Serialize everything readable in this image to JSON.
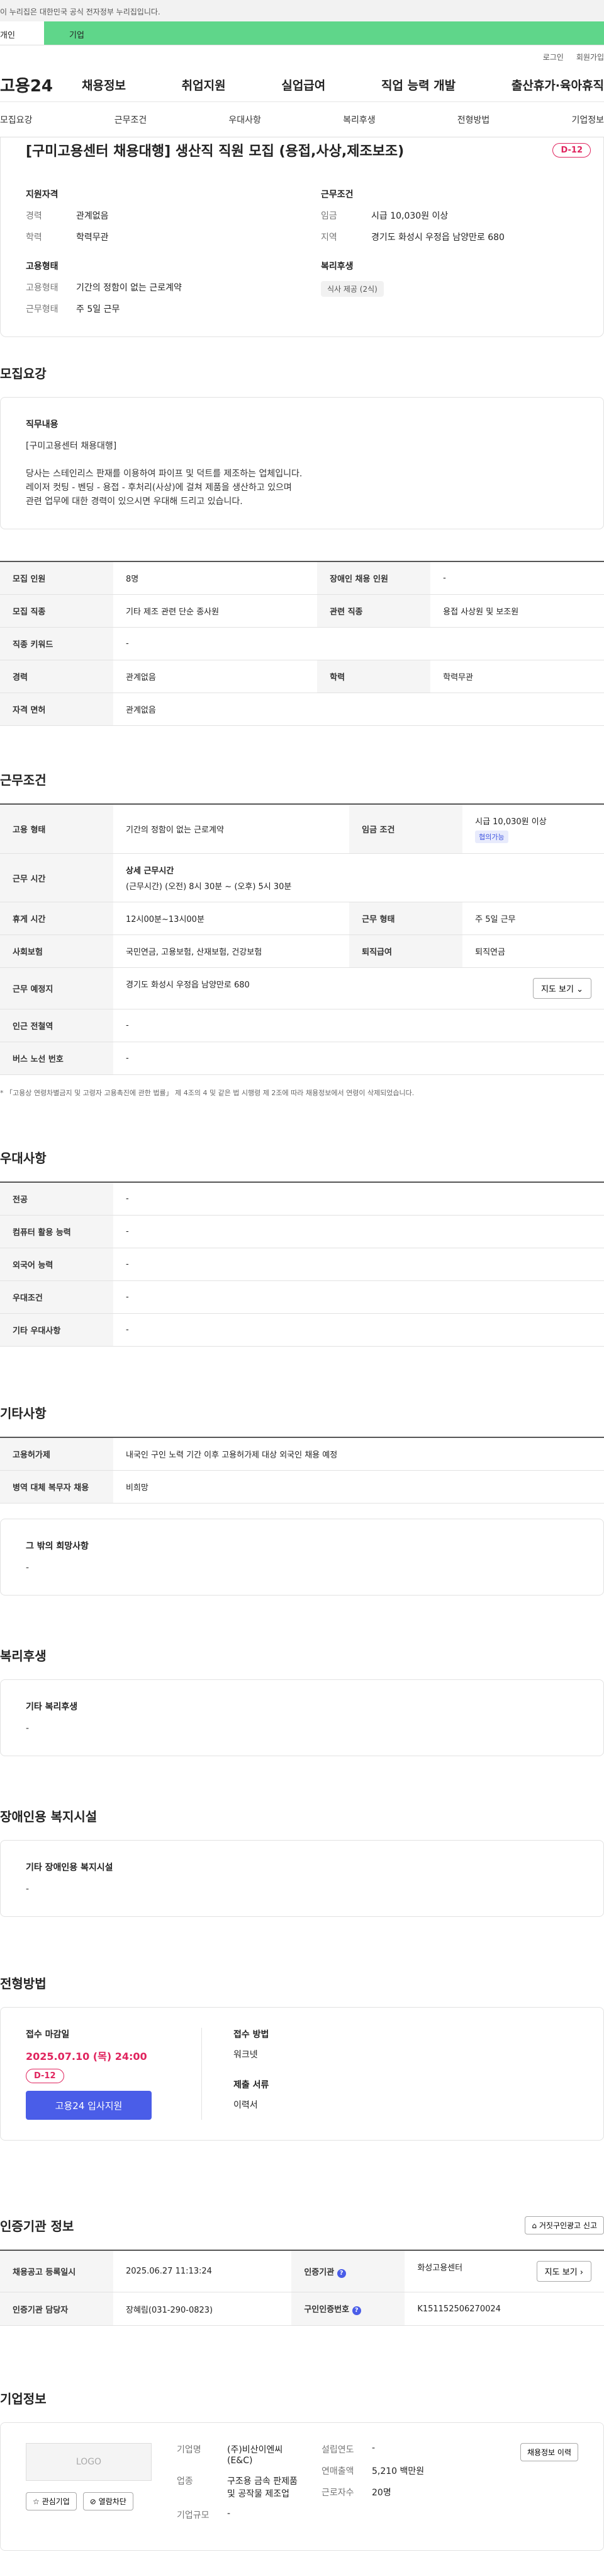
{
  "gov_banner": "이 누리집은 대한민국 공식 전자정부 누리집입니다.",
  "tabs": {
    "personal": "개인",
    "company": "기업"
  },
  "util": {
    "login": "로그인",
    "signup": "회원가입"
  },
  "site_logo": "고용24",
  "gnb": [
    "채용정보",
    "취업지원",
    "실업급여",
    "직업 능력 개발",
    "출산휴가·육아휴직"
  ],
  "anchors": [
    "모집요강",
    "근무조건",
    "우대사항",
    "복리후생",
    "전형방법",
    "기업정보"
  ],
  "header": {
    "title": "[구미고용센터 채용대행] 생산직 직원 모집 (용접,사상,제조보조)",
    "dday": "D-12",
    "qualification_title": "지원자격",
    "career_label": "경력",
    "career": "관계없음",
    "edu_label": "학력",
    "edu": "학력무관",
    "conditions_title": "근무조건",
    "wage_label": "임금",
    "wage": "시급 10,030원 이상",
    "region_label": "지역",
    "region": "경기도 화성시 우정읍 남양만로 680",
    "type_title": "고용형태",
    "emp_label": "고용형태",
    "emp": "기간의 정함이 없는 근로계약",
    "worktype_label": "근무형태",
    "worktype": "주 5일 근무",
    "welfare_title": "복리후생",
    "welfare_chip": "식사 제공 (2식)"
  },
  "recruit": {
    "section_title": "모집요강",
    "duty_title": "직무내용",
    "duty_tag": "[구미고용센터 채용대행]",
    "duty_desc1": "당사는 스테인리스 판재를 이용하여 파이프 및 덕트를 제조하는 업체입니다.",
    "duty_desc2": "레이저 컷팅 - 벤딩 - 용접 - 후처리(사상)에 걸쳐 제품을 생산하고 있으며",
    "duty_desc3": "관련 업무에 대한 경력이 있으시면 우대해 드리고 있습니다.",
    "rows": [
      [
        "모집 인원",
        "8명",
        "장애인 채용 인원",
        "-"
      ],
      [
        "모집 직종",
        "기타 제조 관련 단순 종사원",
        "관련 직종",
        "용접 사상원 및 보조원"
      ],
      [
        "직종 키워드",
        "-",
        "",
        ""
      ],
      [
        "경력",
        "관계없음",
        "학력",
        "학력무관"
      ],
      [
        "자격 면허",
        "관계없음",
        "",
        ""
      ]
    ]
  },
  "conditions": {
    "section_title": "근무조건",
    "emp_label": "고용 형태",
    "emp": "기간의 정함이 없는 근로계약",
    "wage_label": "임금 조건",
    "wage": "시급 10,030원 이상",
    "wage_badge": "협의가능",
    "time_label": "근무 시간",
    "time_title": "상세 근무시간",
    "time_value": "(근무시간) (오전) 8시 30분 ~ (오후) 5시 30분",
    "break_label": "휴게 시간",
    "break": "12시00분~13시00분",
    "worktype_label": "근무 형태",
    "worktype": "주 5일 근무",
    "insurance_label": "사회보험",
    "insurance": "국민연금, 고용보험, 산재보험, 건강보험",
    "retire_label": "퇴직급여",
    "retire": "퇴직연금",
    "place_label": "근무 예정지",
    "place": "경기도 화성시 우정읍 남양만로 680",
    "map_btn": "지도 보기",
    "subway_label": "인근 전철역",
    "subway": "-",
    "bus_label": "버스 노선 번호",
    "bus": "-",
    "note": "* 「고용상 연령차별금지 및 고령자 고용촉진에 관한 법률」 제 4조의 4 및 같은 법 시행령 제 2조에 따라 채용정보에서 연령이 삭제되었습니다."
  },
  "preference": {
    "section_title": "우대사항",
    "rows": [
      [
        "전공",
        "-"
      ],
      [
        "컴퓨터 활용 능력",
        "-"
      ],
      [
        "외국어 능력",
        "-"
      ],
      [
        "우대조건",
        "-"
      ],
      [
        "기타 우대사항",
        "-"
      ]
    ]
  },
  "etc": {
    "section_title": "기타사항",
    "rows": [
      [
        "고용허가제",
        "내국인 구인 노력 기간 이후 고용허가제 대상 외국인 채용 예정"
      ],
      [
        "병역 대체 복무자 채용",
        "비희망"
      ]
    ],
    "hope_title": "그 밖의 희망사항",
    "hope": "-"
  },
  "welfare": {
    "section_title": "복리후생",
    "box_title": "기타 복리후생",
    "box_value": "-"
  },
  "disabled": {
    "section_title": "장애인용 복지시설",
    "box_title": "기타 장애인용 복지시설",
    "box_value": "-"
  },
  "process": {
    "section_title": "전형방법",
    "deadline_title": "접수 마감일",
    "deadline": "2025.07.10 (목) 24:00",
    "dday": "D-12",
    "apply_btn": "고용24 입사지원",
    "method_title": "접수 방법",
    "method": "워크넷",
    "docs_title": "제출 서류",
    "docs": "이력서"
  },
  "cert": {
    "section_title": "인증기관 정보",
    "report_btn": "거짓구인광고 신고",
    "reg_label": "채용공고 등록일시",
    "reg": "2025.06.27 11:13:24",
    "agency_label": "인증기관",
    "agency": "화성고용센터",
    "map_btn": "지도 보기",
    "manager_label": "인증기관 담당자",
    "manager": "장혜림(031-290-0823)",
    "num_label": "구인인증번호",
    "num": "K151152506270024"
  },
  "company": {
    "section_title": "기업정보",
    "logo": "LOGO",
    "fav_btn": "관심기업",
    "block_btn": "열람차단",
    "name_label": "기업명",
    "name": "(주)비산이엔씨(E&C)",
    "industry_label": "업종",
    "industry": "구조용 금속 판제품 및 공작물 제조업",
    "scale_label": "기업규모",
    "scale": "-",
    "est_label": "설립연도",
    "est": "-",
    "sales_label": "연매출액",
    "sales": "5,210 백만원",
    "workers_label": "근로자수",
    "workers": "20명",
    "history_btn": "채용정보 이력"
  }
}
